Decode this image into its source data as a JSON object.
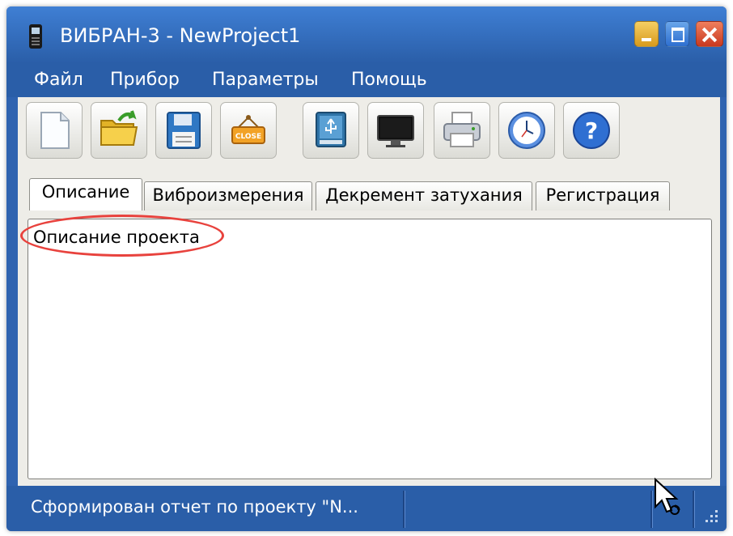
{
  "window": {
    "title": "ВИБРАН-3 - NewProject1",
    "icon": "device-icon"
  },
  "menu": [
    "Файл",
    "Прибор",
    "Параметры",
    "Помощь"
  ],
  "toolbar": {
    "buttons": [
      "new-document-icon",
      "open-folder-icon",
      "save-floppy-icon",
      "close-sign-icon",
      "usb-device-icon",
      "monitor-icon",
      "printer-icon",
      "clock-icon",
      "help-icon"
    ],
    "close_sign_label": "CLOSE"
  },
  "tabs": [
    {
      "label": "Описание",
      "active": true
    },
    {
      "label": "Виброизмерения",
      "active": false
    },
    {
      "label": "Декремент затухания",
      "active": false
    },
    {
      "label": "Регистрация",
      "active": false
    }
  ],
  "content": {
    "description_label": "Описание проекта"
  },
  "status": {
    "text": "Сформирован отчет по проекту \"N..."
  },
  "colors": {
    "accent": "#2f63b0",
    "highlight": "#e8423d"
  }
}
